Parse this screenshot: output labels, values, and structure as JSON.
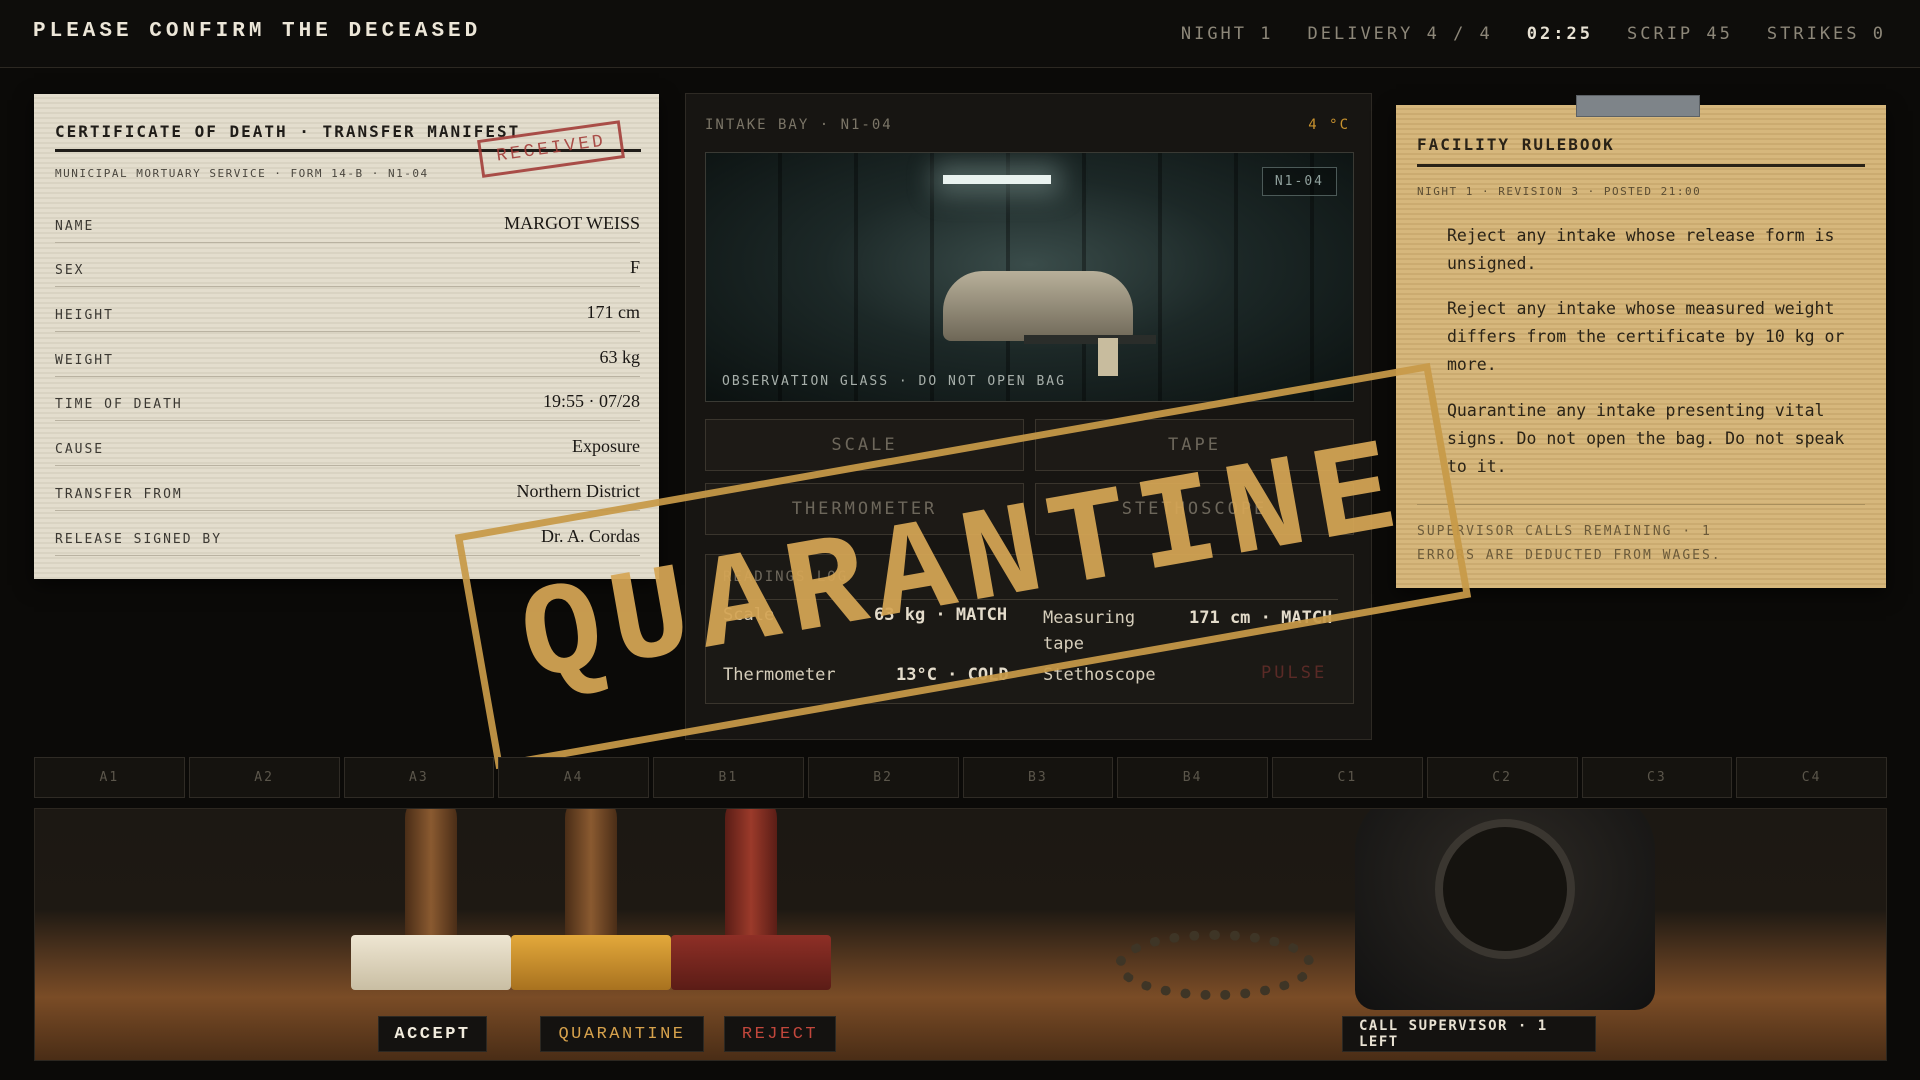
{
  "header": {
    "title": "PLEASE CONFIRM THE DECEASED",
    "night": "NIGHT 1",
    "delivery": "DELIVERY 4 / 4",
    "clock": "02:25",
    "scrip": "SCRIP 45",
    "strikes": "STRIKES 0"
  },
  "certificate": {
    "title": "CERTIFICATE OF DEATH · TRANSFER MANIFEST",
    "subtitle": "MUNICIPAL MORTUARY SERVICE · FORM 14-B · N1-04",
    "stamp": "RECEIVED",
    "fields": [
      {
        "label": "NAME",
        "value": "MARGOT WEISS"
      },
      {
        "label": "SEX",
        "value": "F"
      },
      {
        "label": "HEIGHT",
        "value": "171 cm"
      },
      {
        "label": "WEIGHT",
        "value": "63 kg"
      },
      {
        "label": "TIME OF DEATH",
        "value": "19:55 · 07/28"
      },
      {
        "label": "CAUSE",
        "value": "Exposure"
      },
      {
        "label": "TRANSFER FROM",
        "value": "Northern District"
      },
      {
        "label": "RELEASE SIGNED BY",
        "value": "Dr. A. Cordas"
      }
    ]
  },
  "bay": {
    "title": "INTAKE BAY · N1-04",
    "temp": "4 °C",
    "camera_id": "N1-04",
    "glass_note": "OBSERVATION GLASS · DO NOT OPEN BAG",
    "tools": {
      "scale": "SCALE",
      "tape": "TAPE",
      "thermometer": "THERMOMETER",
      "stethoscope": "STETHOSCOPE"
    },
    "log": {
      "title": "READINGS LOG",
      "rows": [
        {
          "tool": "Scale",
          "result": "63 kg · MATCH"
        },
        {
          "tool": "Measuring tape",
          "result": "171 cm · MATCH"
        },
        {
          "tool": "Thermometer",
          "result": "13°C · COLD"
        },
        {
          "tool": "Stethoscope",
          "result": "PULSE"
        }
      ]
    }
  },
  "rulebook": {
    "title": "FACILITY RULEBOOK",
    "subtitle": "NIGHT 1 · REVISION 3 · POSTED 21:00",
    "rules": [
      "Reject any intake whose release form is unsigned.",
      "Reject any intake whose measured weight differs from the certificate by 10 kg or more.",
      "Quarantine any intake presenting vital signs. Do not open the bag. Do not speak to it."
    ],
    "footer_1": "SUPERVISOR CALLS REMAINING · 1",
    "footer_2": "ERRORS ARE DEDUCTED FROM WAGES."
  },
  "overlay_stamp": "QUARANTINE",
  "slots": [
    "A1",
    "A2",
    "A3",
    "A4",
    "B1",
    "B2",
    "B3",
    "B4",
    "C1",
    "C2",
    "C3",
    "C4"
  ],
  "actions": {
    "accept": "ACCEPT",
    "quarantine": "QUARANTINE",
    "reject": "REJECT",
    "call": "CALL SUPERVISOR · 1 LEFT"
  },
  "colors": {
    "accent_amber": "#c89a48",
    "reject_red": "#c2473c",
    "paper": "#e3ddcd",
    "rulebook_paper": "#d6b77c"
  }
}
